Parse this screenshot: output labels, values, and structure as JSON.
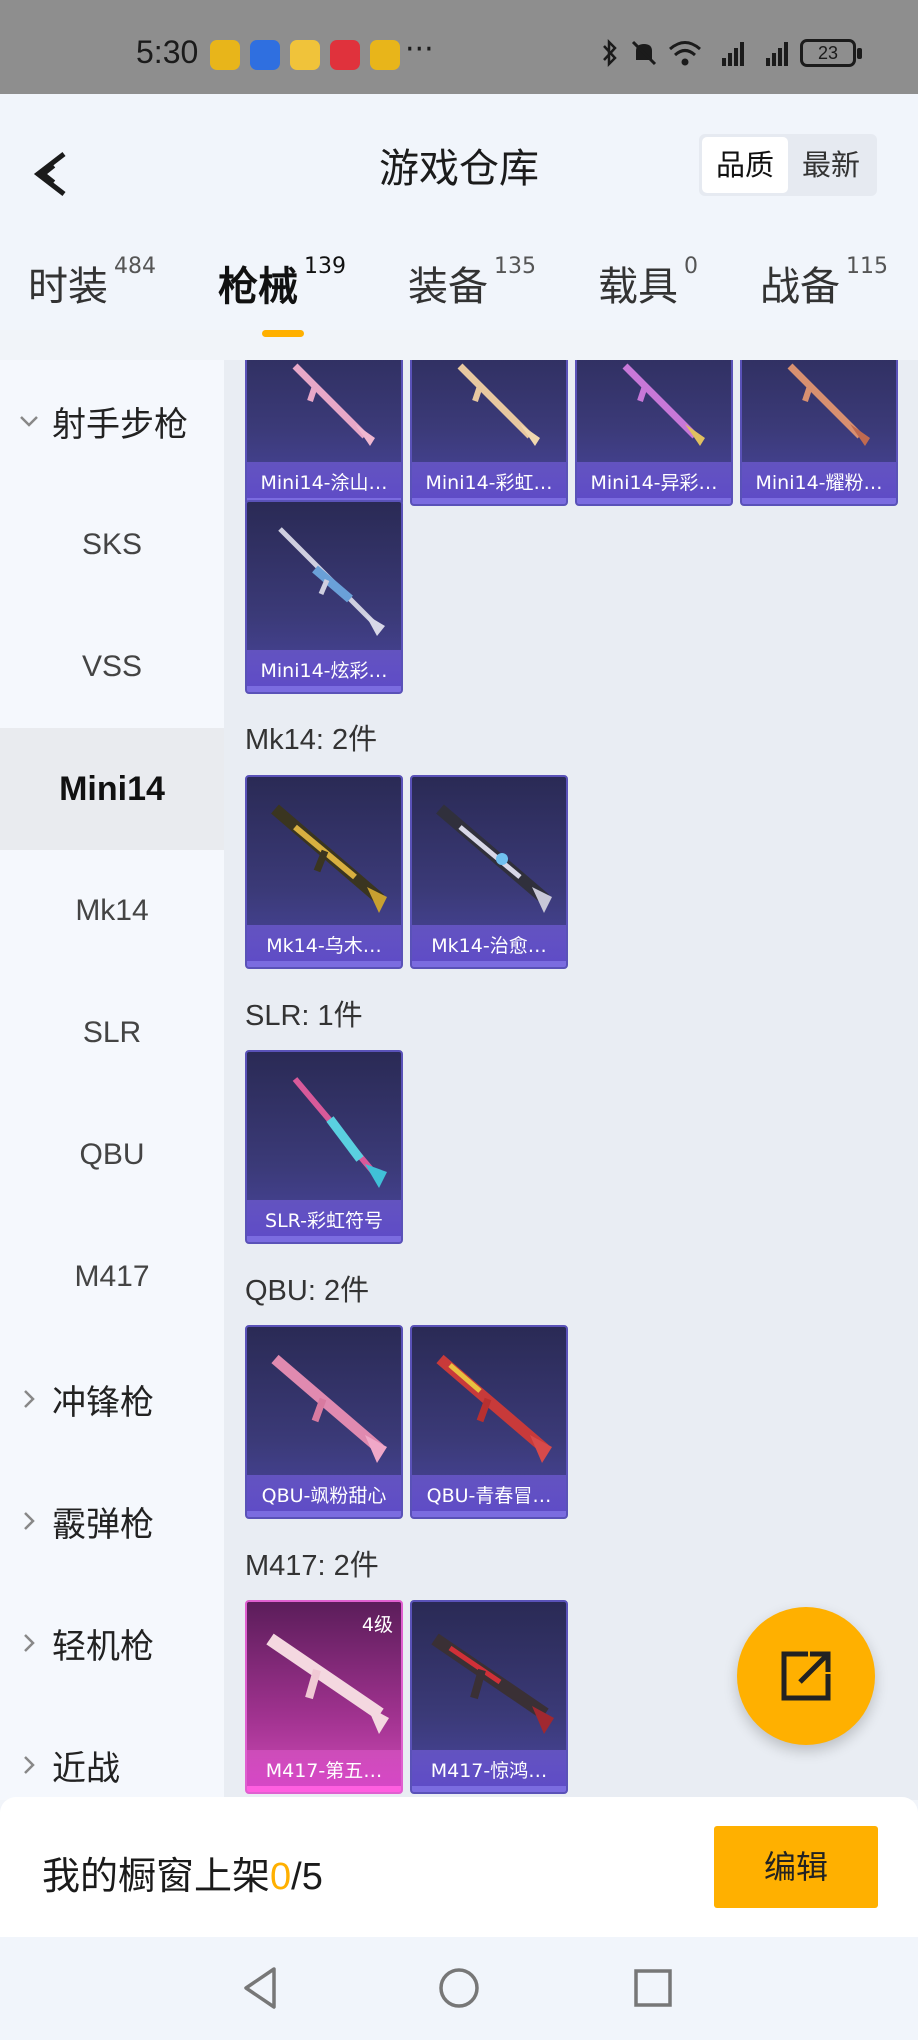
{
  "status_bar": {
    "time": "5:30",
    "more": "···",
    "battery": "23",
    "notification_colors": [
      "#e8b51a",
      "#2f6fe0",
      "#f0c33a",
      "#e0323c",
      "#e8b51a"
    ]
  },
  "header": {
    "title": "游戏仓库",
    "sort_options": [
      "品质",
      "最新"
    ],
    "active_sort": "品质"
  },
  "tabs": [
    {
      "label": "时装",
      "count": "484"
    },
    {
      "label": "枪械",
      "count": "139",
      "active": true
    },
    {
      "label": "装备",
      "count": "135"
    },
    {
      "label": "载具",
      "count": "0"
    },
    {
      "label": "战备",
      "count": "115"
    }
  ],
  "sidebar": {
    "group_open": "射手步枪",
    "items": [
      "SKS",
      "VSS",
      "Mini14",
      "Mk14",
      "SLR",
      "QBU",
      "M417"
    ],
    "active_item": "Mini14",
    "groups_collapsed": [
      "冲锋枪",
      "霰弹枪",
      "轻机枪",
      "近战"
    ]
  },
  "sections": {
    "mini14_items": [
      "Mini14-涂山…",
      "Mini14-彩虹…",
      "Mini14-异彩…",
      "Mini14-耀粉…",
      "Mini14-炫彩…"
    ],
    "mk14_title": "Mk14: 2件",
    "mk14_items": [
      "Mk14-乌木…",
      "Mk14-治愈…"
    ],
    "slr_title": "SLR: 1件",
    "slr_items": [
      "SLR-彩虹符号"
    ],
    "qbu_title": "QBU: 2件",
    "qbu_items": [
      "QBU-飒粉甜心",
      "QBU-青春冒…"
    ],
    "m417_title": "M417: 2件",
    "m417_items": [
      "M417-第五…",
      "M417-惊鸿…"
    ],
    "m417_level": "4级"
  },
  "bottom": {
    "shelf_label": "我的橱窗上架 ",
    "shelf_count": "0",
    "shelf_total": "/5",
    "edit_label": "编辑"
  },
  "icons": {
    "back": "back-chevron-icon",
    "share": "share-external-icon",
    "nav": [
      "nav-back-icon",
      "nav-home-icon",
      "nav-recents-icon"
    ]
  },
  "colors": {
    "accent": "#ffb000",
    "card_purple": "#3b3a78",
    "card_pink": "#d04bb8"
  }
}
